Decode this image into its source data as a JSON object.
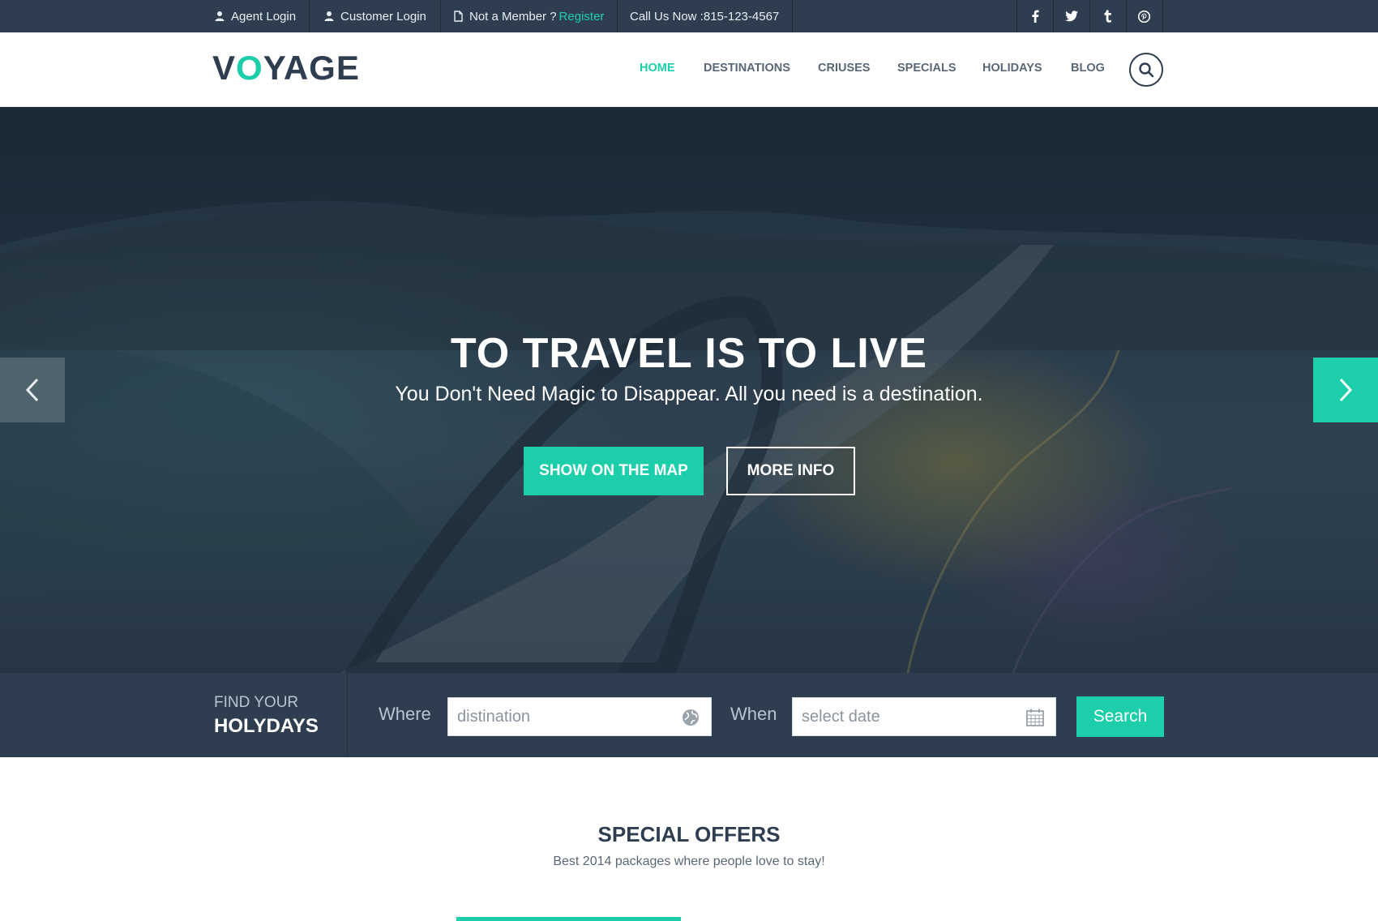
{
  "topbar": {
    "agent_login": "Agent Login",
    "customer_login": "Customer Login",
    "not_member": "Not a Member ?",
    "register": "Register",
    "call": "Call Us Now :815-123-4567",
    "social": [
      "f",
      "twitter-icon",
      "t",
      "pinterest-icon"
    ]
  },
  "header": {
    "logo_v": "V",
    "logo_o": "O",
    "logo_rest": "YAGE",
    "nav": [
      "HOME",
      "DESTINATIONS",
      "CRIUSES",
      "SPECIALS",
      "HOLIDAYS",
      "BLOG"
    ],
    "active": "HOME"
  },
  "hero": {
    "title": "TO TRAVEL IS TO LIVE",
    "subtitle": "You Don't Need Magic to Disappear. All you need is a destination.",
    "btn_map": "SHOW ON THE MAP",
    "btn_info": "MORE INFO"
  },
  "search": {
    "find_line1": "FIND YOUR",
    "find_line2": "HOLYDAYS",
    "where_label": "Where",
    "where_placeholder": "distination",
    "when_label": "When",
    "when_placeholder": "select date",
    "button": "Search"
  },
  "offers": {
    "title": "SPECIAL OFFERS",
    "subtitle": "Best 2014 packages where people love to stay!"
  },
  "colors": {
    "accent": "#1ccfaa",
    "dark": "#2e3e50"
  }
}
